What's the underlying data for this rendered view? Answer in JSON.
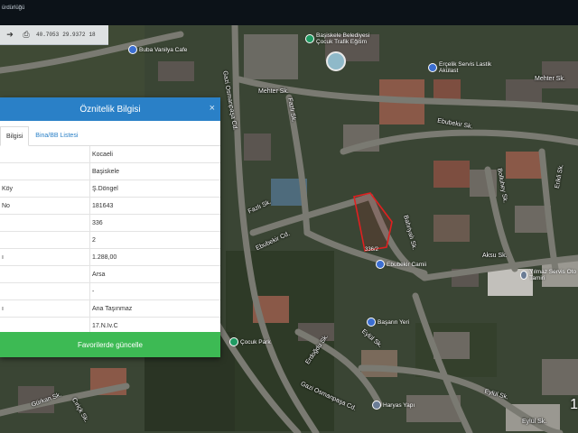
{
  "topbar": {
    "brand": "ürdürlüğü"
  },
  "toolbar": {
    "lat": "40.7053",
    "lon": "29.9372",
    "zoom": "18"
  },
  "map": {
    "road_labels": [
      "Gazi Osmanpaşa Cd.",
      "Mehter Sk.",
      "Mehter Sk.",
      "Fazlı Sk.",
      "Fazlı Sk.",
      "Ebubekir Sk.",
      "Ebubekir Cd.",
      "Bahriyalı Sk.",
      "Bolluhey Sk.",
      "Erikli Sk.",
      "Aksu Sk.",
      "Erdoğdu Sk.",
      "Eylül Sk.",
      "Gürkan Sk.",
      "Cıriçk Sk.",
      "Gazi Osmanpaşa Cd.",
      "Eylül Sk.",
      "Eylül Sk."
    ],
    "pois": [
      "Başiskele Belediyesi Çocuk Trafik Eğitim",
      "Buba Vanilya Cafe",
      "Erçelik Servis Lastik Akülast",
      "Ebubekir Camii",
      "Başarın Yeri",
      "Haryas Yapı",
      "Çocuk Park",
      "Yılmaz Servis Oto Tamiri"
    ],
    "parcel_label": "336/2",
    "corner_number": "1"
  },
  "panel": {
    "title": "Öznitelik Bilgisi",
    "close": "×",
    "tabs": [
      "Bilgisi",
      "Bina/BB Listesi"
    ],
    "rows": [
      {
        "k": "",
        "v": "Kocaeli"
      },
      {
        "k": "",
        "v": "Başiskele"
      },
      {
        "k": "Köy",
        "v": "Ş.Döngel"
      },
      {
        "k": "No",
        "v": "181643"
      },
      {
        "k": "",
        "v": "336"
      },
      {
        "k": "",
        "v": "2"
      },
      {
        "k": "ı",
        "v": "1.288,00"
      },
      {
        "k": "",
        "v": "Arsa"
      },
      {
        "k": "",
        "v": "-"
      },
      {
        "k": "ı",
        "v": "Ana Taşınmaz"
      },
      {
        "k": "",
        "v": "17.N.Iv.C"
      }
    ],
    "update_button": "Favorilerde güncelle"
  },
  "colors": {
    "header": "#2a80c7",
    "update": "#3dba54",
    "parcel_outline": "#e02020"
  }
}
